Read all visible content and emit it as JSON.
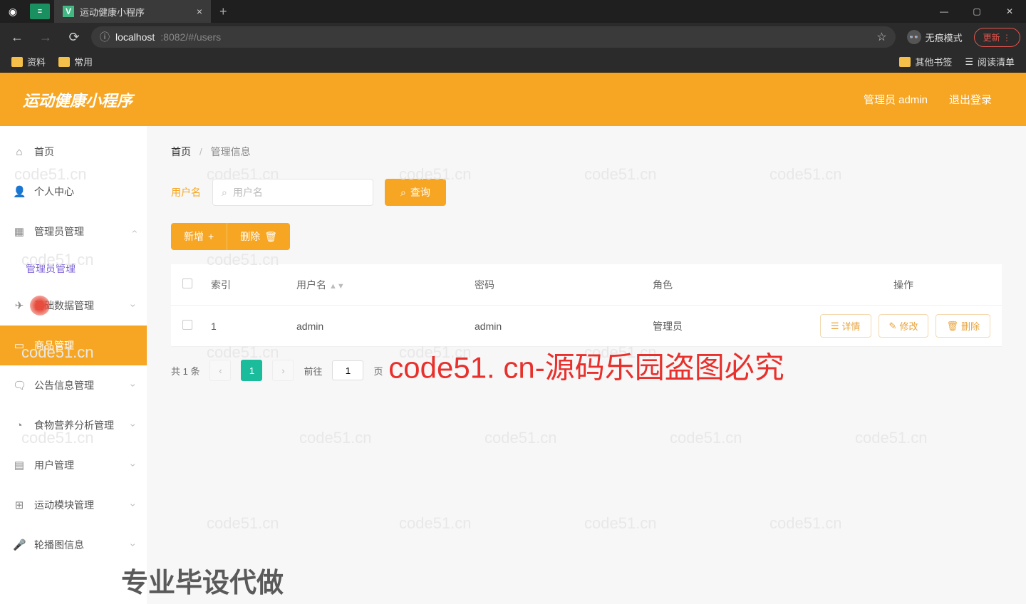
{
  "browser": {
    "tab_title": "运动健康小程序",
    "url_host": "localhost",
    "url_port_path": ":8082/#/users",
    "incognito_label": "无痕模式",
    "update_label": "更新",
    "bookmarks": {
      "left": [
        "资料",
        "常用"
      ],
      "right_other": "其他书签",
      "right_reading": "阅读清单"
    }
  },
  "app": {
    "title": "运动健康小程序",
    "header_user": "管理员 admin",
    "header_logout": "退出登录"
  },
  "sidebar": {
    "items": [
      {
        "icon": "⌂",
        "label": "首页"
      },
      {
        "icon": "👤",
        "label": "个人中心"
      },
      {
        "icon": "▦",
        "label": "管理员管理"
      },
      {
        "icon": "✈",
        "label": "基础数据管理"
      },
      {
        "icon": "▭",
        "label": "商品管理"
      },
      {
        "icon": "🗨",
        "label": "公告信息管理"
      },
      {
        "icon": "◔",
        "label": "食物营养分析管理"
      },
      {
        "icon": "▤",
        "label": "用户管理"
      },
      {
        "icon": "⊞",
        "label": "运动模块管理"
      },
      {
        "icon": "🎤",
        "label": "轮播图信息"
      }
    ],
    "sub_admin": "管理员管理"
  },
  "breadcrumb": {
    "home": "首页",
    "current": "管理信息"
  },
  "search": {
    "label": "用户名",
    "placeholder": "用户名",
    "button": "查询"
  },
  "actions": {
    "add": "新增",
    "delete": "删除"
  },
  "table": {
    "headers": {
      "index": "索引",
      "username": "用户名",
      "password": "密码",
      "role": "角色",
      "ops": "操作"
    },
    "rows": [
      {
        "index": "1",
        "username": "admin",
        "password": "admin",
        "role": "管理员"
      }
    ],
    "ops": {
      "detail": "详情",
      "edit": "修改",
      "delete": "删除"
    }
  },
  "pagination": {
    "total": "共 1 条",
    "current": "1",
    "goto_prefix": "前往",
    "goto_value": "1",
    "goto_suffix": "页"
  },
  "watermark": {
    "center": "code51. cn-源码乐园盗图必究",
    "footer": "专业毕设代做",
    "bg": "code51.cn"
  }
}
